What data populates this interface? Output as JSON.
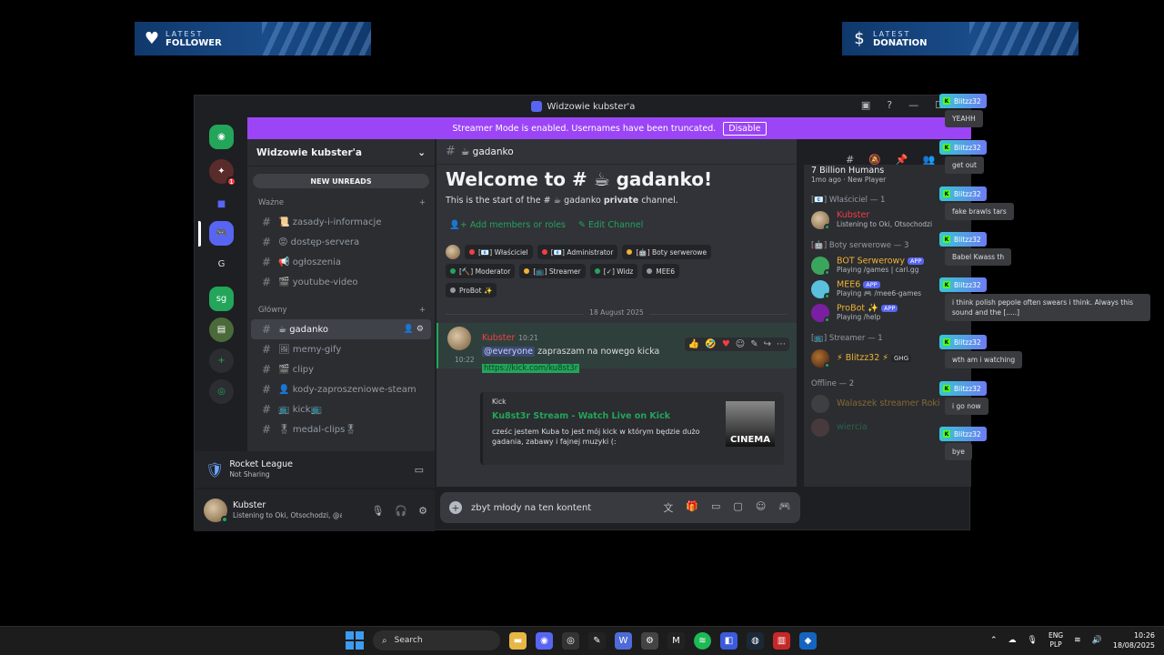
{
  "overlay": {
    "follower": {
      "l1": "LATEST",
      "l2": "FOLLOWER",
      "icon": "heart-icon"
    },
    "donation": {
      "l1": "LATEST",
      "l2": "DONATION",
      "icon": "dollar-icon"
    }
  },
  "window": {
    "title": "Widzowie kubster'a"
  },
  "streamer_bar": {
    "text": "Streamer Mode is enabled. Usernames have been truncated.",
    "button": "Disable"
  },
  "rail": {
    "letter_server": "G",
    "sg_server": "sg",
    "mention_count": "1"
  },
  "sidebar": {
    "guild_name": "Widzowie kubster'a",
    "new_unreads": "NEW UNREADS",
    "cat1": "Ważne",
    "cat1_channels": [
      {
        "name": "📜 zasady-i-informacje"
      },
      {
        "name": "😡 dostęp-servera"
      },
      {
        "name": "📢 ogłoszenia"
      },
      {
        "name": "🎬 youtube-video"
      }
    ],
    "cat2": "Główny",
    "cat2_channels": [
      {
        "name": "☕ gadanko"
      },
      {
        "name": "🖼 memy-gify"
      },
      {
        "name": "🎬 clipy"
      },
      {
        "name": "👤 kody-zaproszeniowe-steam"
      },
      {
        "name": "📺 kick📺"
      },
      {
        "name": "🎖 medal-clips🎖"
      }
    ]
  },
  "activity": {
    "title": "Rocket League",
    "sub": "Not Sharing"
  },
  "user_panel": {
    "name": "Kubster",
    "status": "Listening to Oki, Otsochodzi, @at..."
  },
  "chat": {
    "channel": "☕ gadanko",
    "welcome_title": "Welcome to # ☕ gadanko!",
    "welcome_sub_pre": "This is the start of the # ☕ gadanko ",
    "welcome_sub_bold": "private",
    "welcome_sub_post": " channel.",
    "action1": "Add members or roles",
    "action2": "Edit Channel",
    "roles": [
      {
        "label": "[📧] Właściciel",
        "color": "#f23f43"
      },
      {
        "label": "[📧] Administrator",
        "color": "#f23f43"
      },
      {
        "label": "[🤖] Boty serwerowe",
        "color": "#f0b232"
      },
      {
        "label": "[🔨] Moderator",
        "color": "#23a55a"
      },
      {
        "label": "[📺] Streamer",
        "color": "#f0b232"
      },
      {
        "label": "[✓] Widz",
        "color": "#23a55a"
      },
      {
        "label": "MEE6",
        "color": "#949ba4"
      },
      {
        "label": "ProBot ✨",
        "color": "#949ba4"
      }
    ],
    "date_divider": "18 August 2025",
    "message": {
      "author": "Kubster",
      "time": "10:21",
      "mention": "@everyone",
      "text": "zapraszam na nowego kicka",
      "link": "https://kick.com/ku8st3r",
      "side_time": "10:22"
    },
    "embed": {
      "provider": "Kick",
      "title": "Ku8st3r Stream - Watch Live on Kick",
      "desc": "cześc jestem Kuba to jest mój kick w którym będzie dużo gadania, zabawy i fajnej muzyki (:",
      "thumb_text": "CINEMA"
    },
    "composer_text": "zbyt młody na ten kontent"
  },
  "members": {
    "top_name": "7 Billion Humans",
    "top_sub": "1mo ago · New Player",
    "grp_owner": "[📧] Właściciel — 1",
    "owner": {
      "name": "Kubster",
      "sub": "Listening to Oki, Otsochodzi"
    },
    "grp_bots": "[🤖] Boty serwerowe — 3",
    "bots": [
      {
        "name": "BOT Serwerowy",
        "sub": "Playing /games | cari.gg",
        "color": "#f0b232",
        "avatar": "#3ba55c"
      },
      {
        "name": "MEE6",
        "sub": "Playing 🎮 /mee6-games",
        "color": "#f0b232",
        "avatar": "#5bc0de"
      },
      {
        "name": "ProBot ✨",
        "sub": "Playing /help",
        "color": "#f0b232",
        "avatar": "#7b1fa2"
      }
    ],
    "app_tag": "APP",
    "grp_streamer": "[📺] Streamer — 1",
    "streamer": {
      "name": "⚡ Blitzz32 ⚡",
      "tag": "GHG"
    },
    "grp_offline": "Offline — 2",
    "offline": [
      {
        "name": "Walaszek streamer Roki"
      },
      {
        "name": "wiercia"
      }
    ]
  },
  "stream_chat": [
    {
      "user": "Blitzz32",
      "msg": "YEAHH"
    },
    {
      "user": "Blitzz32",
      "msg": "get out"
    },
    {
      "user": "Blitzz32",
      "msg": "fake brawls tars"
    },
    {
      "user": "Blitzz32",
      "msg": "Babel Kwass th"
    },
    {
      "user": "Blitzz32",
      "msg": "i think polish pepole often swears i think. Always this sound and the [.....]"
    },
    {
      "user": "Blitzz32",
      "msg": "wth am i watching"
    },
    {
      "user": "Blitzz32",
      "msg": "i go now"
    },
    {
      "user": "Blitzz32",
      "msg": "bye"
    }
  ],
  "taskbar": {
    "search": "Search",
    "lang1": "ENG",
    "lang2": "PLP",
    "time": "10:26",
    "date": "18/08/2025"
  }
}
